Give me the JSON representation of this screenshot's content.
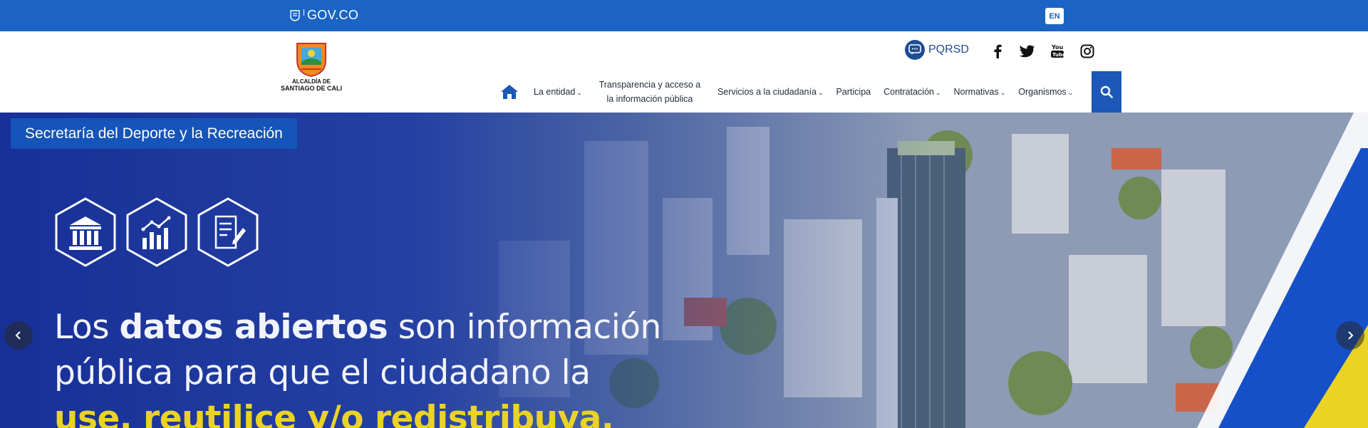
{
  "govbar": {
    "brand": "GOV.CO",
    "lang_label": "EN",
    "strip_colors": [
      "#1b64c4",
      "#2aa6d9",
      "#d62b2b",
      "#8f3cc9"
    ]
  },
  "header": {
    "logo": {
      "line1": "ALCALDÍA DE",
      "line2": "SANTIAGO DE CALI"
    },
    "pqrsd_label": "PQRSD",
    "social": [
      "facebook-icon",
      "twitter-icon",
      "youtube-icon",
      "instagram-icon"
    ]
  },
  "nav": {
    "items": [
      {
        "label": "La entidad",
        "dropdown": true
      },
      {
        "label": "Transparencia y acceso a la información pública",
        "dropdown": false
      },
      {
        "label": "Servicios a la ciudadanía",
        "dropdown": true
      },
      {
        "label": "Participa",
        "dropdown": false
      },
      {
        "label": "Contratación",
        "dropdown": true
      },
      {
        "label": "Normativas",
        "dropdown": true
      },
      {
        "label": "Organismos",
        "dropdown": true
      }
    ]
  },
  "hero": {
    "tag": "Secretaría del Deporte y la Recreación",
    "headline": {
      "part1": "Los ",
      "bold": "datos abiertos",
      "part2": " son información",
      "line2": "pública para que el ciudadano la",
      "line3": "use, reutilice y/o redistribuya."
    },
    "icons": [
      "institution-icon",
      "chart-icon",
      "document-icon"
    ],
    "colors": {
      "overlay": "#1a3aa0",
      "accent_yellow": "#ead324",
      "tag_bg": "#1554b8"
    }
  }
}
